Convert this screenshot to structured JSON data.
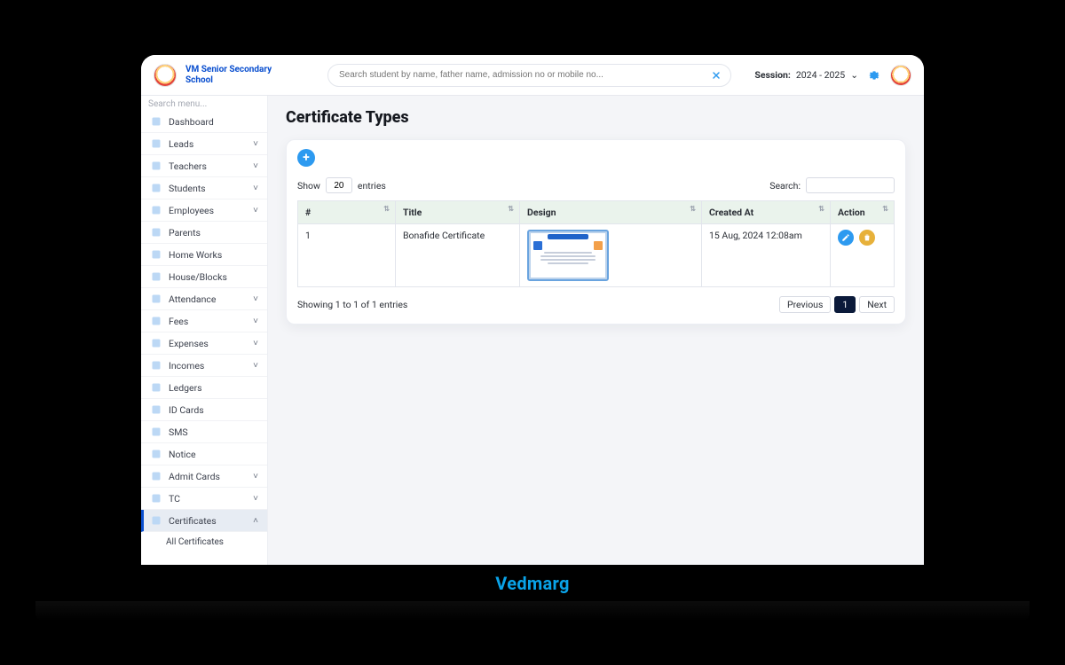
{
  "brand_footer": "Vedmarg",
  "header": {
    "school_name": "VM Senior Secondary School",
    "search_placeholder": "Search student by name, father name, admission no or mobile no...",
    "session_label": "Session:",
    "session_value": "2024 - 2025"
  },
  "sidebar": {
    "search_placeholder": "Search menu...",
    "items": [
      {
        "label": "Dashboard",
        "expandable": false
      },
      {
        "label": "Leads",
        "expandable": true
      },
      {
        "label": "Teachers",
        "expandable": true
      },
      {
        "label": "Students",
        "expandable": true
      },
      {
        "label": "Employees",
        "expandable": true
      },
      {
        "label": "Parents",
        "expandable": false
      },
      {
        "label": "Home Works",
        "expandable": false
      },
      {
        "label": "House/Blocks",
        "expandable": false
      },
      {
        "label": "Attendance",
        "expandable": true
      },
      {
        "label": "Fees",
        "expandable": true
      },
      {
        "label": "Expenses",
        "expandable": true
      },
      {
        "label": "Incomes",
        "expandable": true
      },
      {
        "label": "Ledgers",
        "expandable": false
      },
      {
        "label": "ID Cards",
        "expandable": false
      },
      {
        "label": "SMS",
        "expandable": false
      },
      {
        "label": "Notice",
        "expandable": false
      },
      {
        "label": "Admit Cards",
        "expandable": true
      },
      {
        "label": "TC",
        "expandable": true
      },
      {
        "label": "Certificates",
        "expandable": true,
        "active": true
      }
    ],
    "sub_item": "All Certificates"
  },
  "page": {
    "title": "Certificate Types",
    "show_label_pre": "Show",
    "show_value": "20",
    "show_label_post": "entries",
    "search_label": "Search:",
    "columns": {
      "idx": "#",
      "title": "Title",
      "design": "Design",
      "created": "Created At",
      "action": "Action"
    },
    "rows": [
      {
        "idx": "1",
        "title": "Bonafide Certificate",
        "created": "15 Aug, 2024 12:08am"
      }
    ],
    "footer_info": "Showing 1 to 1 of 1 entries",
    "pager": {
      "prev": "Previous",
      "current": "1",
      "next": "Next"
    }
  }
}
